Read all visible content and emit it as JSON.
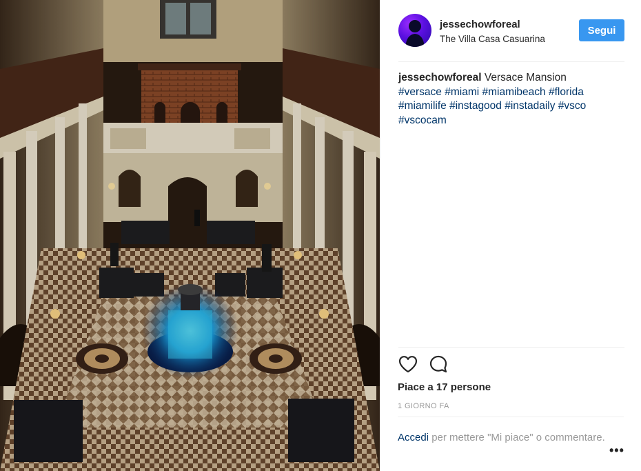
{
  "post": {
    "photo": {
      "description_icon": "photo-courtyard"
    },
    "header": {
      "username": "jessechowforeal",
      "location": "The Villa Casa Casuarina",
      "follow_label": "Segui"
    },
    "caption": {
      "username": "jessechowforeal",
      "text": "Versace Mansion",
      "hashtags": [
        "#versace",
        "#miami",
        "#miamibeach",
        "#florida",
        "#miamilife",
        "#instagood",
        "#instadaily",
        "#vsco",
        "#vscocam"
      ]
    },
    "actions": {
      "like_icon": "heart-outline-icon",
      "comment_icon": "comment-bubble-icon"
    },
    "likes_text": "Piace a 17 persone",
    "timestamp": "1 GIORNO FA",
    "login": {
      "link": "Accedi",
      "rest": "per mettere \"Mi piace\" o commentare."
    },
    "more_label": "•••",
    "colors": {
      "accent": "#3897f0",
      "link": "#003569",
      "muted": "#999999",
      "text": "#262626"
    }
  }
}
